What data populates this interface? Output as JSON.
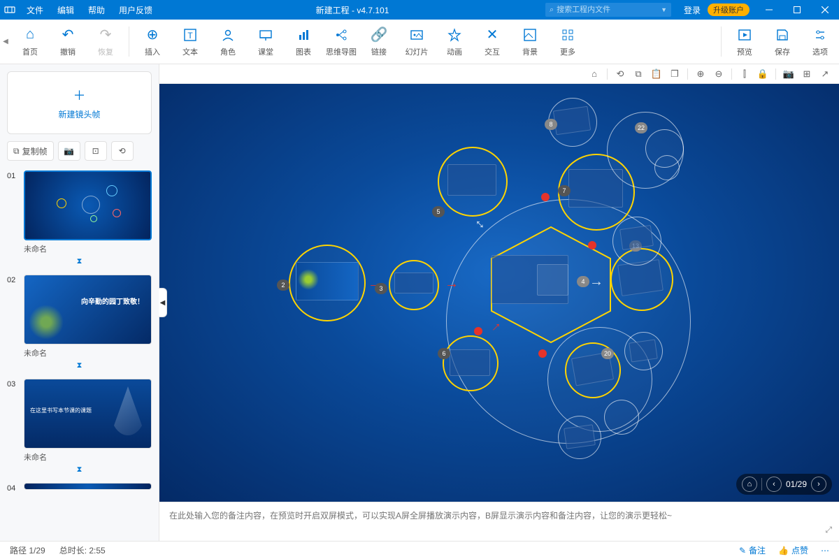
{
  "menu": {
    "file": "文件",
    "edit": "编辑",
    "help": "帮助",
    "feedback": "用户反馈"
  },
  "title": "新建工程 - v4.7.101",
  "search_placeholder": "搜索工程内文件",
  "login": "登录",
  "upgrade": "升级账户",
  "tools": {
    "home": "首页",
    "undo": "撤销",
    "redo": "恢复",
    "insert": "插入",
    "text": "文本",
    "role": "角色",
    "class": "课堂",
    "chart": "图表",
    "mindmap": "思维导图",
    "link": "链接",
    "slide": "幻灯片",
    "anim": "动画",
    "interact": "交互",
    "bg": "背景",
    "more": "更多",
    "preview": "预览",
    "save": "保存",
    "options": "选项"
  },
  "sidebar": {
    "new_frame": "新建镜头帧",
    "copy_frame": "复制帧",
    "slides": [
      {
        "num": "01",
        "name": "未命名"
      },
      {
        "num": "02",
        "name": "未命名",
        "title": "向辛勤的园丁致敬！"
      },
      {
        "num": "03",
        "name": "未命名",
        "title": "在这里书写本节课的课题"
      },
      {
        "num": "04",
        "name": ""
      }
    ]
  },
  "canvas_nav": {
    "pos": "01/29"
  },
  "notes_placeholder": "在此处输入您的备注内容，在预览时开启双屏模式，可以实现A屏全屏播放演示内容，B屏显示演示内容和备注内容，让您的演示更轻松~",
  "status": {
    "path": "路径 1/29",
    "duration": "总时长: 2:55",
    "notes": "备注",
    "like": "点赞"
  }
}
